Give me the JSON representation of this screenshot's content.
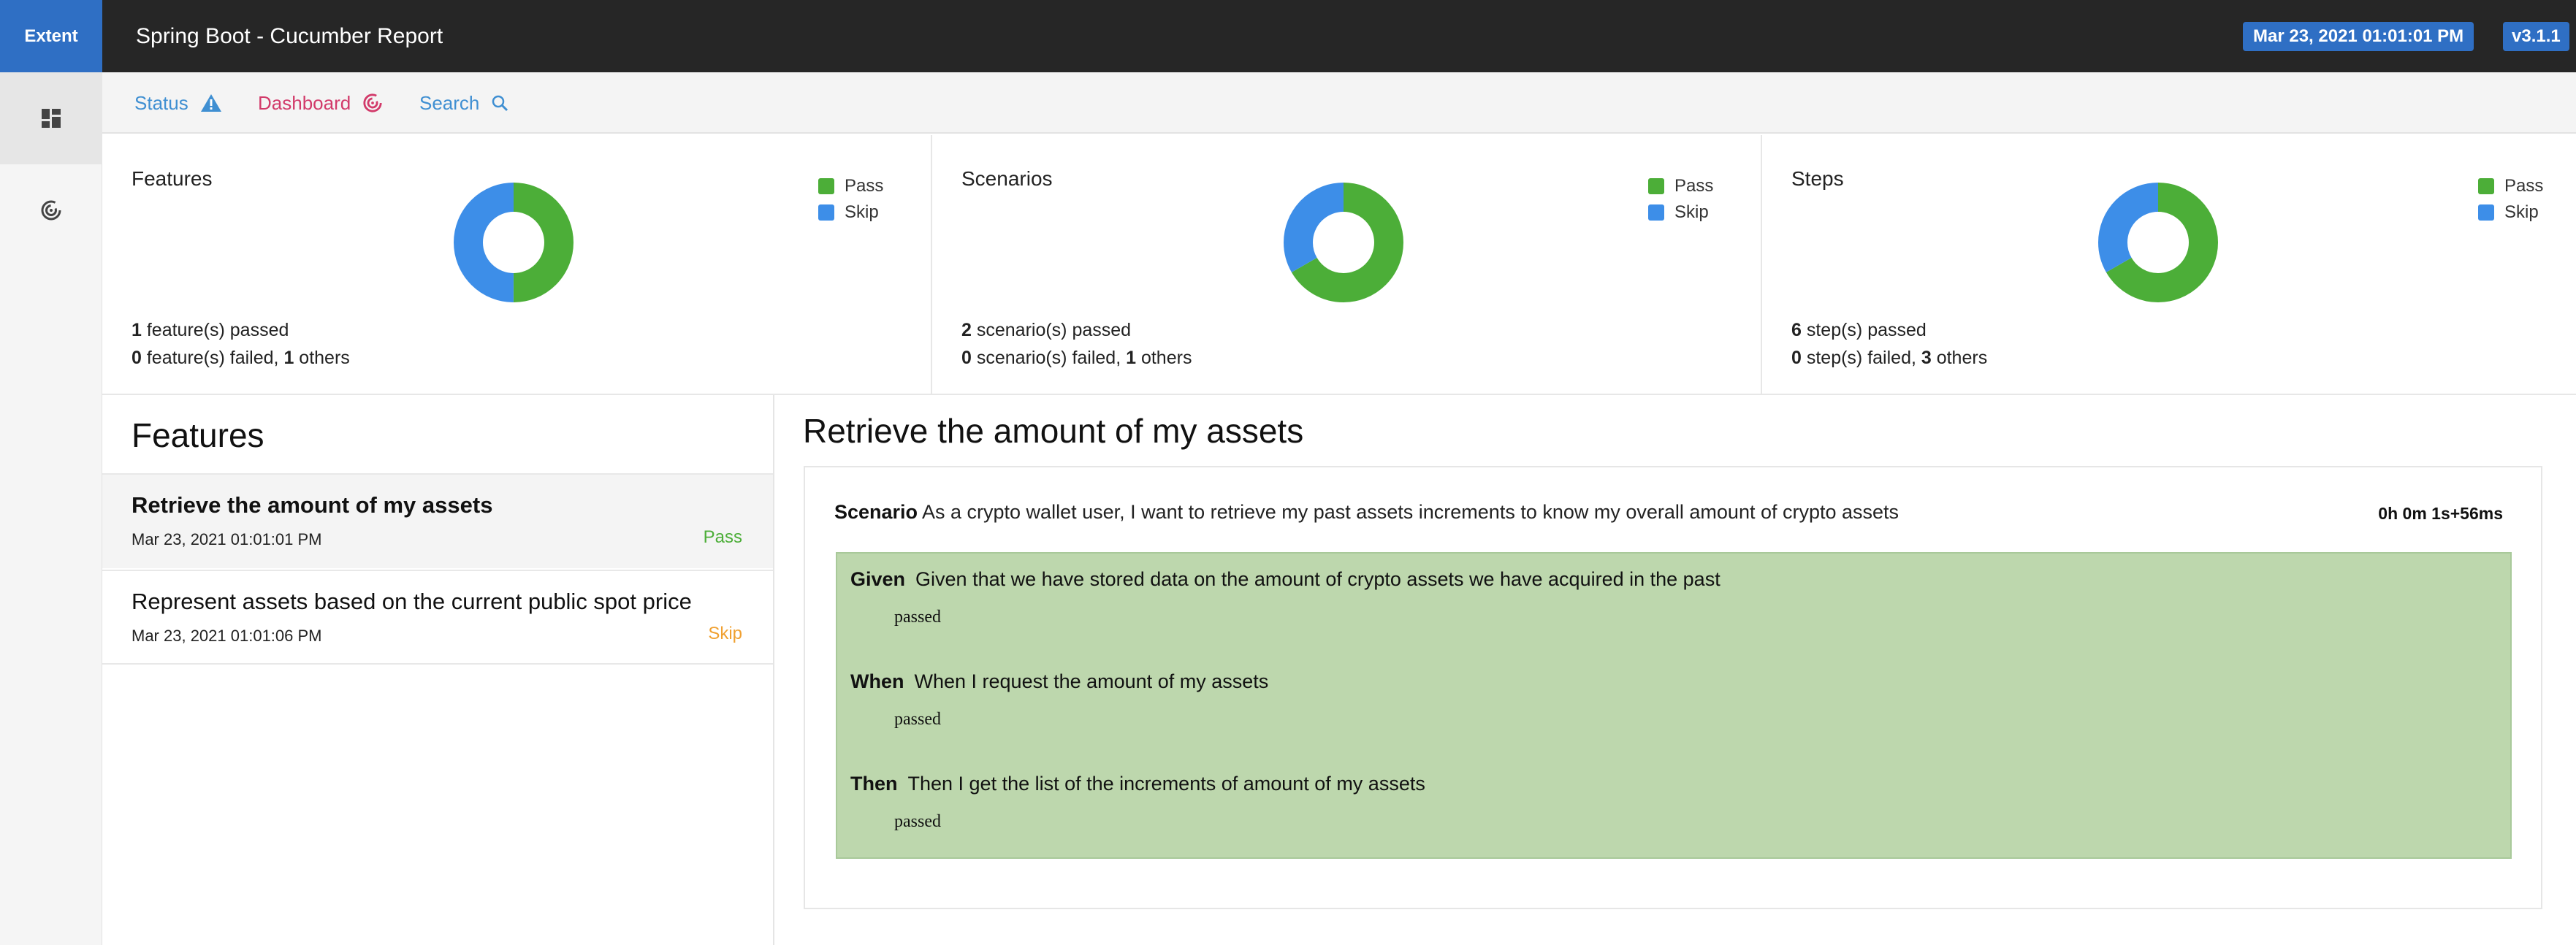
{
  "topbar": {
    "brand": "Extent",
    "title": "Spring Boot - Cucumber Report",
    "date": "Mar 23, 2021 01:01:01 PM",
    "version": "v3.1.1"
  },
  "sidebar": {
    "items": [
      {
        "icon": "dashboard-grid-icon",
        "active": true
      },
      {
        "icon": "target-icon",
        "active": false
      }
    ]
  },
  "subnav": {
    "status_label": "Status",
    "dashboard_label": "Dashboard",
    "search_label": "Search"
  },
  "colors": {
    "pass": "#4cae38",
    "skip": "#3d8ee8",
    "accent": "#2f6fc4",
    "step_pass_bg": "#bdd7ad"
  },
  "summary": {
    "features": {
      "title": "Features",
      "legend": [
        "Pass",
        "Skip"
      ],
      "pass": 1,
      "skip": 1,
      "line1_count": "1",
      "line1_text": " feature(s) passed",
      "line2_count": "0",
      "line2_mid": " feature(s) failed, ",
      "line2_others": "1",
      "line2_end": " others"
    },
    "scenarios": {
      "title": "Scenarios",
      "legend": [
        "Pass",
        "Skip"
      ],
      "pass": 2,
      "skip": 1,
      "line1_count": "2",
      "line1_text": " scenario(s) passed",
      "line2_count": "0",
      "line2_mid": " scenario(s) failed, ",
      "line2_others": "1",
      "line2_end": " others"
    },
    "steps": {
      "title": "Steps",
      "legend": [
        "Pass",
        "Skip"
      ],
      "pass": 6,
      "skip": 3,
      "line1_count": "6",
      "line1_text": " step(s) passed",
      "line2_count": "0",
      "line2_mid": " step(s) failed, ",
      "line2_others": "3",
      "line2_end": " others"
    }
  },
  "features_list": {
    "heading": "Features",
    "items": [
      {
        "name": "Retrieve the amount of my assets",
        "date": "Mar 23, 2021 01:01:01 PM",
        "status": "Pass"
      },
      {
        "name": "Represent assets based on the current public spot price",
        "date": "Mar 23, 2021 01:01:06 PM",
        "status": "Skip"
      }
    ]
  },
  "detail": {
    "title": "Retrieve the amount of my assets",
    "scenario_label": "Scenario",
    "scenario_text": "As a crypto wallet user, I want to retrieve my past assets increments to know my overall amount of crypto assets",
    "duration": "0h 0m 1s+56ms",
    "steps": [
      {
        "keyword": "Given",
        "text": "Given that we have stored data on the amount of crypto assets we have acquired in the past",
        "status": "passed"
      },
      {
        "keyword": "When",
        "text": "When I request the amount of my assets",
        "status": "passed"
      },
      {
        "keyword": "Then",
        "text": "Then I get the list of the increments of amount of my assets",
        "status": "passed"
      }
    ]
  }
}
